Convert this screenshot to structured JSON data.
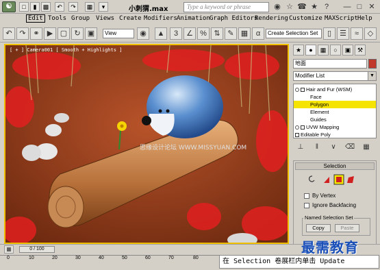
{
  "title": "小刺猬.max",
  "search_placeholder": "Type a keyword or phrase",
  "menu": [
    "Edit",
    "Tools",
    "Group",
    "Views",
    "Create",
    "Modifiers",
    "Animation",
    "Graph Editors",
    "Rendering",
    "Customize",
    "MAXScript",
    "Help"
  ],
  "toolbar": {
    "view_select": "View",
    "named_selection": "Create Selection Set",
    "snap_label": "3"
  },
  "viewport": {
    "label": "[ + ] Camera001 [ Smooth + Highlights ]",
    "watermark": "思缘设计论坛 WWW.MISSYUAN.COM",
    "border_color": "#f0c000"
  },
  "panel": {
    "object_name": "地面",
    "modifier_list": "Modifier List",
    "stack": [
      {
        "label": "Hair and Fur (WSM)",
        "level": 0,
        "icon": "bulb",
        "highlight": false
      },
      {
        "label": "Face",
        "level": 1,
        "highlight": false
      },
      {
        "label": "Polygon",
        "level": 1,
        "highlight": true
      },
      {
        "label": "Element",
        "level": 1,
        "highlight": false
      },
      {
        "label": "Guides",
        "level": 1,
        "highlight": false
      },
      {
        "label": "UVW Mapping",
        "level": 0,
        "icon": "bulb",
        "highlight": false
      },
      {
        "label": "Editable Poly",
        "level": 0,
        "icon": "box",
        "highlight": false
      }
    ],
    "selection": {
      "header": "Selection",
      "by_vertex": "By Vertex",
      "ignore_backfacing": "Ignore Backfacing",
      "named_sets": "Named Selection Set",
      "copy": "Copy",
      "paste": "Paste"
    }
  },
  "timeline": {
    "frame": "0 / 100",
    "ticks": [
      "0",
      "10",
      "20",
      "30",
      "40",
      "50",
      "60",
      "70",
      "80"
    ]
  },
  "caption": "在 Selection 卷展栏内单击 Update",
  "brand": "最需教育",
  "colors": {
    "accent": "#f5e400",
    "brand": "#1a4fb8"
  }
}
